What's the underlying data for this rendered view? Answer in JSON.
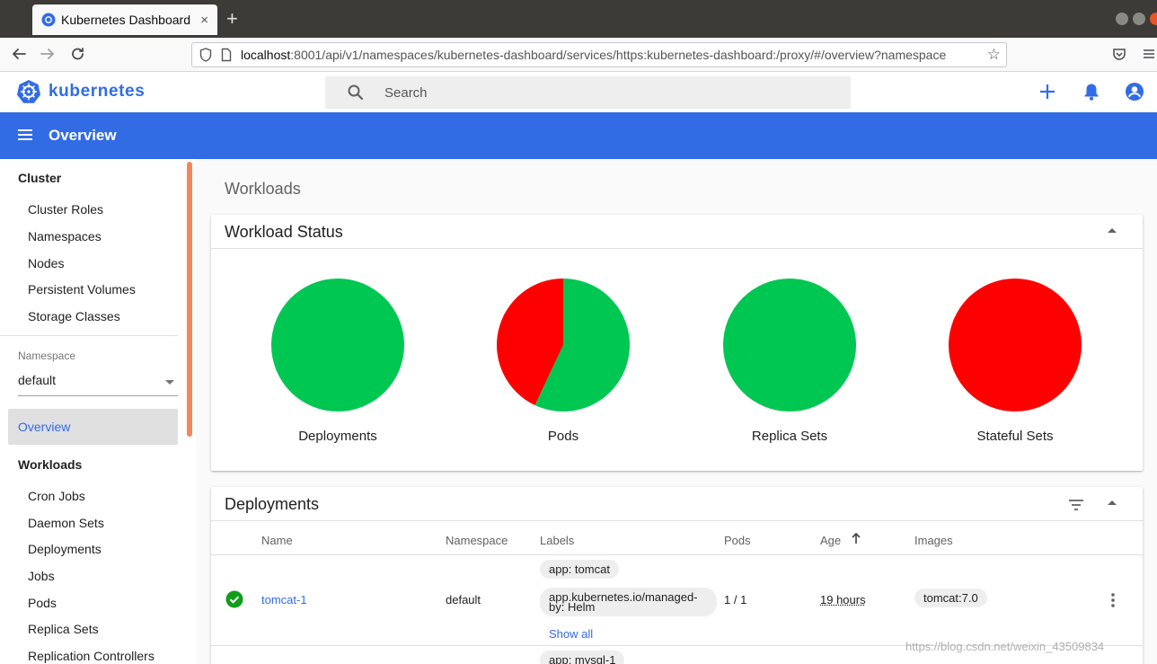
{
  "browser": {
    "tab_title": "Kubernetes Dashboard",
    "tab_close": "×",
    "new_tab": "+",
    "url_host": "localhost",
    "url_rest": ":8001/api/v1/namespaces/kubernetes-dashboard/services/https:kubernetes-dashboard:/proxy/#/overview?namespace"
  },
  "app": {
    "name": "kubernetes",
    "search_placeholder": "Search",
    "page_title": "Overview",
    "brand_color": "#326ce5"
  },
  "sidebar": {
    "cluster_heading": "Cluster",
    "cluster_items": [
      "Cluster Roles",
      "Namespaces",
      "Nodes",
      "Persistent Volumes",
      "Storage Classes"
    ],
    "namespace_label": "Namespace",
    "namespace_value": "default",
    "active_item": "Overview",
    "workloads_heading": "Workloads",
    "workload_items": [
      "Cron Jobs",
      "Daemon Sets",
      "Deployments",
      "Jobs",
      "Pods",
      "Replica Sets",
      "Replication Controllers"
    ]
  },
  "main": {
    "section_title": "Workloads",
    "status_card_title": "Workload Status",
    "deployments_card_title": "Deployments",
    "columns": [
      "Name",
      "Namespace",
      "Labels",
      "Pods",
      "Age",
      "Images"
    ],
    "rows": [
      {
        "name": "tomcat-1",
        "namespace": "default",
        "labels": [
          "app: tomcat",
          "app.kubernetes.io/managed-by: Helm"
        ],
        "show_all": "Show all",
        "pods": "1 / 1",
        "age": "19 hours",
        "image": "tomcat:7.0",
        "status": "running"
      },
      {
        "labels": [
          "app: mysql-1"
        ]
      }
    ]
  },
  "chart_data": {
    "type": "pie",
    "colors": {
      "ok": "#00c752",
      "failed": "#ff0000"
    },
    "series": [
      {
        "name": "Deployments",
        "values": [
          1,
          0
        ]
      },
      {
        "name": "Pods",
        "values": [
          0.57,
          0.43
        ]
      },
      {
        "name": "Replica Sets",
        "values": [
          1,
          0
        ]
      },
      {
        "name": "Stateful Sets",
        "values": [
          0,
          1
        ]
      }
    ]
  },
  "watermark": "https://blog.csdn.net/weixin_43509834"
}
